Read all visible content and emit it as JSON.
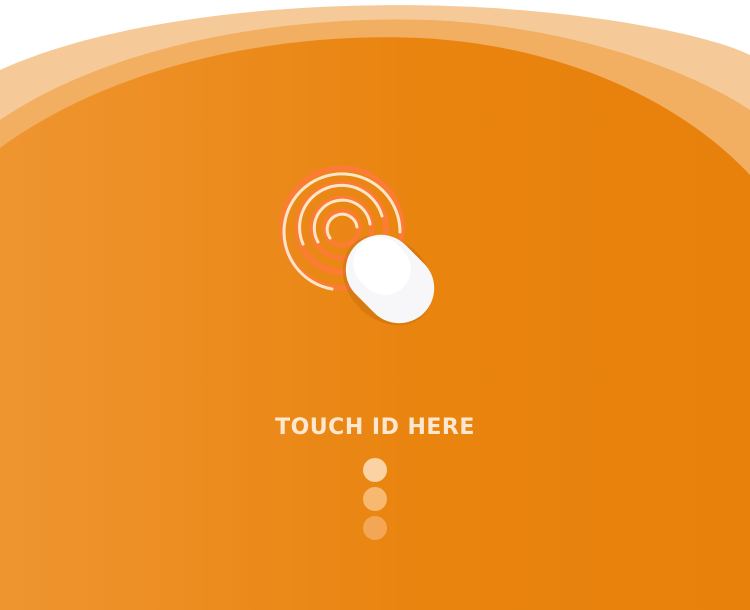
{
  "touch_prompt": {
    "label": "TOUCH ID HERE"
  },
  "icons": {
    "fingerprint": "fingerprint-icon",
    "finger": "finger-tap-icon"
  },
  "progress": {
    "steps_total": 3
  },
  "colors": {
    "background_orange": "#e8820f",
    "wave_light": "#f8c98f",
    "label_text": "#fde7cf",
    "ring": "#ff7a3a",
    "ring_inner": "#ffe6c9"
  }
}
